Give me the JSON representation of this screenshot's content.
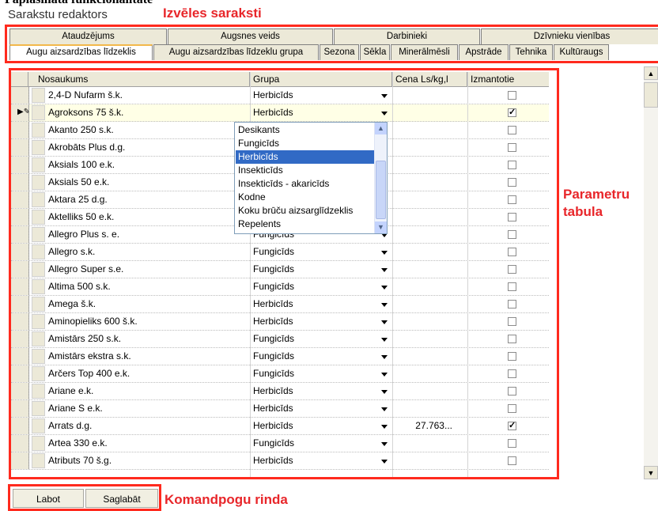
{
  "cropped_heading": "Paplasinātā funkcionalitāte",
  "app_title": "Sarakstu redaktors",
  "annotations": {
    "lists": "Izvēles saraksti",
    "params_line1": "Parametru",
    "params_line2": "tabula",
    "commands": "Komandpogu rinda"
  },
  "tabs_top": [
    "Ataudzējums",
    "Augsnes veids",
    "Darbinieki",
    "Dzīvnieku vienības"
  ],
  "tabs_bottom": [
    "Augu aizsardzības līdzeklis",
    "Augu aizsardzības līdzeklu grupa",
    "Sezona",
    "Sēkla",
    "Minerālmēsli",
    "Apstrāde",
    "Tehnika",
    "Kultūraugs"
  ],
  "grid": {
    "columns": [
      "Nosaukums",
      "Grupa",
      "Cena Ls/kg,l",
      "Izmantotie"
    ],
    "rows": [
      {
        "name": "2,4-D Nufarm š.k.",
        "group": "Herbicīds",
        "price": "",
        "used": false
      },
      {
        "name": "Agroksons 75 š.k.",
        "group": "Herbicīds",
        "price": "",
        "used": true
      },
      {
        "name": "Akanto 250 s.k.",
        "group": "",
        "price": "",
        "used": false
      },
      {
        "name": "Akrobāts Plus d.g.",
        "group": "",
        "price": "",
        "used": false
      },
      {
        "name": "Aksials 100 e.k.",
        "group": "",
        "price": "",
        "used": false
      },
      {
        "name": "Aksials 50 e.k.",
        "group": "",
        "price": "",
        "used": false
      },
      {
        "name": "Aktara 25 d.g.",
        "group": "",
        "price": "",
        "used": false
      },
      {
        "name": "Aktelliks 50 e.k.",
        "group": "",
        "price": "",
        "used": false
      },
      {
        "name": "Allegro Plus s. e.",
        "group": "Fungicīds",
        "price": "",
        "used": false
      },
      {
        "name": "Allegro s.k.",
        "group": "Fungicīds",
        "price": "",
        "used": false
      },
      {
        "name": "Allegro Super s.e.",
        "group": "Fungicīds",
        "price": "",
        "used": false
      },
      {
        "name": "Altima 500 s.k.",
        "group": "Fungicīds",
        "price": "",
        "used": false
      },
      {
        "name": "Amega š.k.",
        "group": "Herbicīds",
        "price": "",
        "used": false
      },
      {
        "name": "Aminopieliks 600 š.k.",
        "group": "Herbicīds",
        "price": "",
        "used": false
      },
      {
        "name": "Amistārs 250 s.k.",
        "group": "Fungicīds",
        "price": "",
        "used": false
      },
      {
        "name": "Amistārs ekstra s.k.",
        "group": "Fungicīds",
        "price": "",
        "used": false
      },
      {
        "name": "Arčers Top 400 e.k.",
        "group": "Fungicīds",
        "price": "",
        "used": false
      },
      {
        "name": "Ariane e.k.",
        "group": "Herbicīds",
        "price": "",
        "used": false
      },
      {
        "name": "Ariane S e.k.",
        "group": "Herbicīds",
        "price": "",
        "used": false
      },
      {
        "name": "Arrats d.g.",
        "group": "Herbicīds",
        "price": "27.763...",
        "used": true
      },
      {
        "name": "Artea 330 e.k.",
        "group": "Fungicīds",
        "price": "",
        "used": false
      },
      {
        "name": "Atributs 70 š.g.",
        "group": "Herbicīds",
        "price": "",
        "used": false
      }
    ]
  },
  "dropdown_options": [
    "Desikants",
    "Fungicīds",
    "Herbicīds",
    "Insekticīds",
    "Insekticīds - akaricīds",
    "Kodne",
    "Koku brūču aizsarglīdzeklis",
    "Repelents"
  ],
  "dropdown_selected": "Herbicīds",
  "buttons": {
    "edit": "Labot",
    "save": "Saglabāt"
  },
  "icons": [
    "row-pointer-icon",
    "dropdown-arrow-icon",
    "scroll-up-icon",
    "scroll-down-icon"
  ]
}
